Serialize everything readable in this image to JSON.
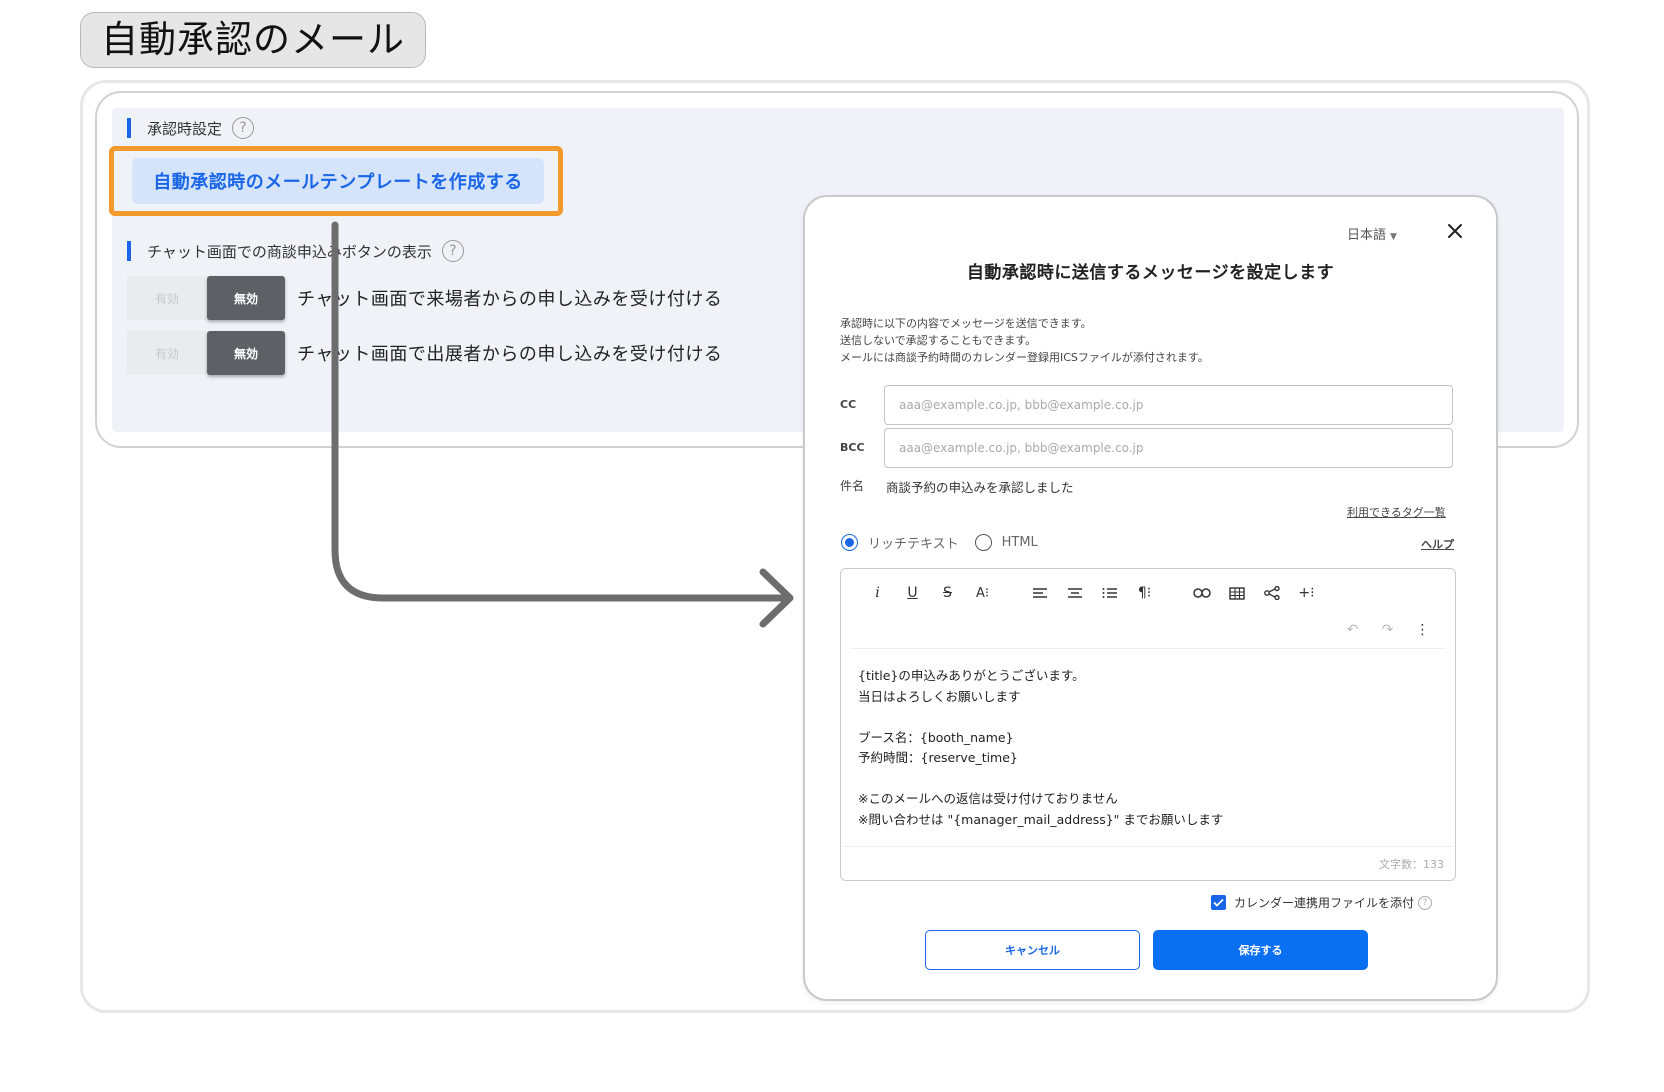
{
  "page_title": "自動承認のメール",
  "settings": {
    "approval_heading": "承認時設定",
    "create_template_button": "自動承認時のメールテンプレートを作成する",
    "chat_heading": "チャット画面での商談申込みボタンの表示",
    "help_glyph": "?",
    "toggles": [
      {
        "on_label": "有効",
        "off_label": "無効",
        "label": "チャット画面で来場者からの申し込みを受け付ける",
        "selected": "無効"
      },
      {
        "on_label": "有効",
        "off_label": "無効",
        "label": "チャット画面で出展者からの申し込みを受け付ける",
        "selected": "無効"
      }
    ]
  },
  "modal": {
    "language": "日本語",
    "title": "自動承認時に送信するメッセージを設定します",
    "description": [
      "承認時に以下の内容でメッセージを送信できます。",
      "送信しないで承認することもできます。",
      "メールには商談予約時間のカレンダー登録用ICSファイルが添付されます。"
    ],
    "cc": {
      "label": "CC",
      "placeholder": "aaa@example.co.jp, bbb@example.co.jp",
      "value": ""
    },
    "bcc": {
      "label": "BCC",
      "placeholder": "aaa@example.co.jp, bbb@example.co.jp",
      "value": ""
    },
    "subject": {
      "label": "件名",
      "value": "商談予約の申込みを承認しました"
    },
    "tags_link": "利用できるタグ一覧",
    "help_link": "ヘルプ",
    "format_options": [
      {
        "label": "リッチテキスト",
        "selected": true
      },
      {
        "label": "HTML",
        "selected": false
      }
    ],
    "editor_body": [
      "{title}の申込みありがとうございます。",
      "当日はよろしくお願いします",
      "",
      "ブース名：{booth_name}",
      "予約時間：{reserve_time}",
      "",
      "※このメールへの返信は受け付けておりません",
      "※問い合わせは \"{manager_mail_address}\" までお願いします"
    ],
    "char_count": "文字数：133",
    "attach_calendar": {
      "label": "カレンダー連携用ファイルを添付",
      "checked": true
    },
    "cancel_button": "キャンセル",
    "save_button": "保存する"
  },
  "colors": {
    "accent": "#1a66e8",
    "highlight": "#f39a2d",
    "arrow": "#6d6d6d",
    "save_button": "#0b6ff2"
  },
  "icons": [
    "help-icon",
    "close-icon",
    "chevron-down-icon",
    "italic-icon",
    "underline-icon",
    "strikethrough-icon",
    "font-size-icon",
    "align-left-icon",
    "align-center-icon",
    "list-icon",
    "paragraph-icon",
    "link-icon",
    "table-icon",
    "share-icon",
    "insert-icon",
    "undo-icon",
    "redo-icon",
    "more-icon",
    "checkbox-icon",
    "arrow-icon"
  ]
}
